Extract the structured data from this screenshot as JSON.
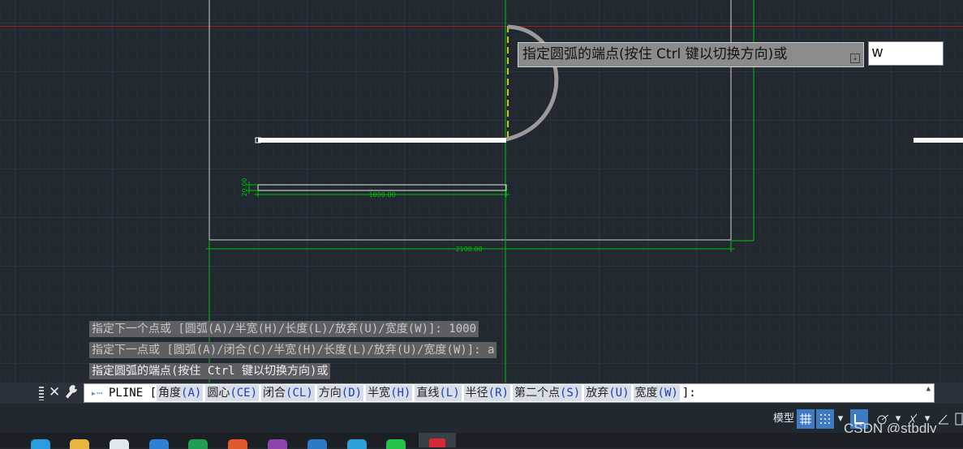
{
  "drawing": {
    "dimension_small_height": "20.00",
    "dimension_small_width": "1000.00",
    "dimension_outer_width": "2100.00"
  },
  "tooltip": {
    "prompt": "指定圆弧的端点(按住 Ctrl 键以切换方向)或",
    "icon": "down-arrow-icon"
  },
  "dynamic_input": {
    "value": "w"
  },
  "history": [
    "指定下一个点或 [圆弧(A)/半宽(H)/长度(L)/放弃(U)/宽度(W)]: 1000",
    "指定下一点或 [圆弧(A)/闭合(C)/半宽(H)/长度(L)/放弃(U)/宽度(W)]: a",
    "指定圆弧的端点(按住 Ctrl 键以切换方向)或"
  ],
  "command_line": {
    "command": "PLINE",
    "open_bracket": "[",
    "options": [
      {
        "label": "角度",
        "key": "(A)"
      },
      {
        "label": "圆心",
        "key": "(CE)"
      },
      {
        "label": "闭合",
        "key": "(CL)"
      },
      {
        "label": "方向",
        "key": "(D)"
      },
      {
        "label": "半宽",
        "key": "(H)"
      },
      {
        "label": "直线",
        "key": "(L)"
      },
      {
        "label": "半径",
        "key": "(R)"
      },
      {
        "label": "第二个点",
        "key": "(S)"
      },
      {
        "label": "放弃",
        "key": "(U)"
      },
      {
        "label": "宽度",
        "key": "(W)"
      }
    ],
    "close_bracket": "]:",
    "close_icon": "✕",
    "customize_icon": "wrench-icon"
  },
  "status_bar": {
    "model_label": "模型",
    "grid_icon": "grid-icon",
    "snap_icon": "snap-icon",
    "ortho_icon": "ortho-icon",
    "polar_icon": "polar-icon",
    "osnap_icon": "osnap-icon"
  },
  "watermark": "CSDN @stbdly",
  "colors": {
    "background": "#212830",
    "green": "#00c000",
    "red": "#b01818",
    "white": "#ffffff",
    "history_bg": "#5d5f63",
    "accent": "#3f7bc2"
  }
}
